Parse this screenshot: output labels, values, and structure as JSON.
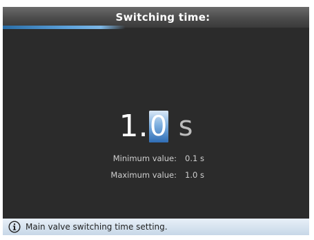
{
  "header": {
    "title": "Switching time:"
  },
  "value": {
    "integer": "1",
    "separator": ".",
    "selected_digit": "0",
    "unit": "s"
  },
  "limits": {
    "min_label": "Minimum value:",
    "min_value": "0.1 s",
    "max_label": "Maximum value:",
    "max_value": "1.0 s"
  },
  "status": {
    "icon": "info-icon",
    "text": "Main valve switching time setting."
  },
  "colors": {
    "background": "#2c2c2c",
    "accent": "#5fa4dd",
    "status_bar": "#d6e3ef"
  }
}
